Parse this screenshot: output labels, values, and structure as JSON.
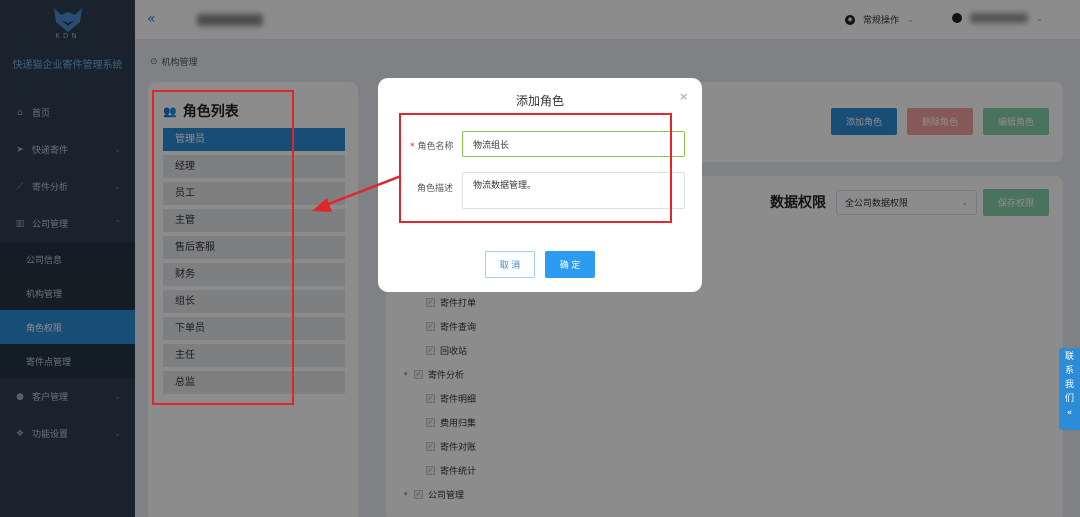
{
  "app": {
    "logo_text": "KDN",
    "name": "快递猫企业寄件管理系统"
  },
  "sidebar": {
    "items": [
      {
        "label": "首页",
        "icon": "home-icon"
      },
      {
        "label": "快递寄件",
        "icon": "send-icon"
      },
      {
        "label": "寄件分析",
        "icon": "chart-icon"
      },
      {
        "label": "公司管理",
        "icon": "building-icon"
      }
    ],
    "sub_items": [
      {
        "label": "公司信息"
      },
      {
        "label": "机构管理"
      },
      {
        "label": "角色权限"
      },
      {
        "label": "寄件点管理"
      }
    ],
    "items_after": [
      {
        "label": "客户管理",
        "icon": "user-icon"
      },
      {
        "label": "功能设置",
        "icon": "settings-icon"
      }
    ]
  },
  "header": {
    "ops_label": "常规操作"
  },
  "breadcrumb": {
    "label": "机构管理"
  },
  "roles": {
    "title": "角色列表",
    "items": [
      "管理员",
      "经理",
      "员工",
      "主管",
      "售后客服",
      "财务",
      "组长",
      "下单员",
      "主任",
      "总监"
    ]
  },
  "toolbar": {
    "add_label": "添加角色",
    "delete_label": "删除角色",
    "edit_label": "编辑角色"
  },
  "permissions": {
    "title": "数据权限",
    "select_value": "全公司数据权限",
    "save_label": "保存权限",
    "tree": [
      {
        "label": "寄件打单",
        "level": 1
      },
      {
        "label": "寄件查询",
        "level": 1
      },
      {
        "label": "回收站",
        "level": 1
      },
      {
        "label": "寄件分析",
        "level": 0
      },
      {
        "label": "寄件明细",
        "level": 1
      },
      {
        "label": "费用归集",
        "level": 1
      },
      {
        "label": "寄件对账",
        "level": 1
      },
      {
        "label": "寄件统计",
        "level": 1
      },
      {
        "label": "公司管理",
        "level": 0
      }
    ]
  },
  "dialog": {
    "title": "添加角色",
    "name_label": "角色名称",
    "name_value": "物流组长",
    "desc_label": "角色描述",
    "desc_value": "物流数据管理。",
    "cancel_label": "取 消",
    "ok_label": "确 定"
  },
  "contact": {
    "chars": [
      "联",
      "系",
      "我",
      "们",
      "«"
    ]
  }
}
